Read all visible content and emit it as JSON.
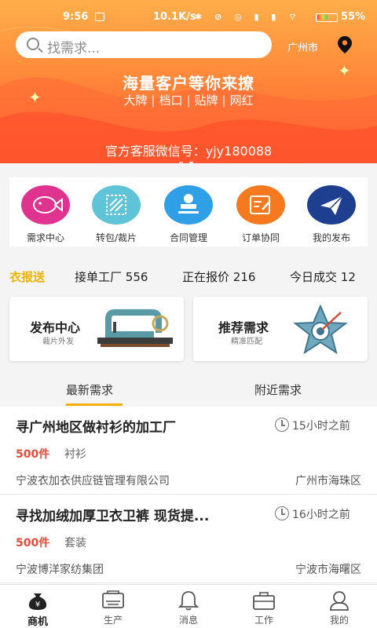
{
  "status_bar": {
    "time": "9:56",
    "speed": "10.1K/s",
    "battery": "55%",
    "battery_level": 0.55
  },
  "search": {
    "placeholder": "找需求..."
  },
  "location": {
    "city": "广州市"
  },
  "banner": {
    "title": "海量客户等你来撩",
    "tags": [
      "大牌",
      "档口",
      "贴牌",
      "网红"
    ],
    "wechat": "官方客服微信号：yjy180088"
  },
  "quick_entries": [
    {
      "label": "需求中心",
      "icon": "fish-icon",
      "color": "#e0338f"
    },
    {
      "label": "转包/裁片",
      "icon": "fabric-icon",
      "color": "#5fc4d7"
    },
    {
      "label": "合同管理",
      "icon": "stamp-icon",
      "color": "#2f9fe6"
    },
    {
      "label": "订单协同",
      "icon": "edit-note-icon",
      "color": "#f57a1f"
    },
    {
      "label": "我的发布",
      "icon": "paper-plane-icon",
      "color": "#1e3f8f"
    }
  ],
  "stats": {
    "brand": "衣报送",
    "items": [
      {
        "label": "接单工厂",
        "value": "556"
      },
      {
        "label": "正在报价",
        "value": "216"
      },
      {
        "label": "今日成交",
        "value": "12"
      }
    ]
  },
  "cards": [
    {
      "title": "发布中心",
      "subtitle": "裁片外发",
      "icon": "sewing-machine-icon"
    },
    {
      "title": "推荐需求",
      "subtitle": "精准匹配",
      "icon": "star-target-icon"
    }
  ],
  "tabs": [
    {
      "label": "最新需求",
      "active": true
    },
    {
      "label": "附近需求",
      "active": false
    }
  ],
  "listings": [
    {
      "title": "寻广州地区做衬衫的加工厂",
      "time": "15小时之前",
      "qty": "500件",
      "category": "衬衫",
      "company": "宁波衣加衣供应链管理有限公司",
      "location": "广州市海珠区"
    },
    {
      "title": "寻找加绒加厚卫衣卫裤 现货提...",
      "time": "16小时之前",
      "qty": "500件",
      "category": "套装",
      "company": "宁波博洋家纺集团",
      "location": "宁波市海曙区"
    }
  ],
  "bottom_nav": [
    {
      "label": "商机",
      "icon": "money-bag-icon",
      "active": true
    },
    {
      "label": "生产",
      "icon": "printer-icon",
      "active": false
    },
    {
      "label": "消息",
      "icon": "bell-icon",
      "active": false
    },
    {
      "label": "工作",
      "icon": "briefcase-icon",
      "active": false
    },
    {
      "label": "我的",
      "icon": "user-icon",
      "active": false
    }
  ]
}
